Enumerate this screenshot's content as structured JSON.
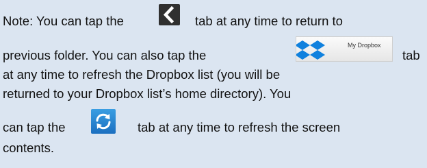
{
  "note": {
    "line1_before": "Note: You can tap the",
    "line1_after": "tab at any time to return to",
    "line2_before": "previous folder. You can also tap the",
    "line2_after": "tab",
    "line3": "at any time to refresh the Dropbox list (you will be",
    "line4": "returned to your Dropbox list’s home directory). You",
    "line5_before": "can tap the",
    "line5_after": "tab at any time to refresh the screen",
    "line6": "contents."
  },
  "icons": {
    "back": "chevron-left-icon",
    "dropbox": "dropbox-logo-icon",
    "refresh": "refresh-icon"
  },
  "dropbox_tab": {
    "label": "My Dropbox"
  },
  "colors": {
    "background": "#dbe5f1",
    "text": "#111111",
    "back_tab": "#2f2f2f",
    "dropbox_blue": "#1081de",
    "refresh_tab": "#1b6fc0"
  }
}
